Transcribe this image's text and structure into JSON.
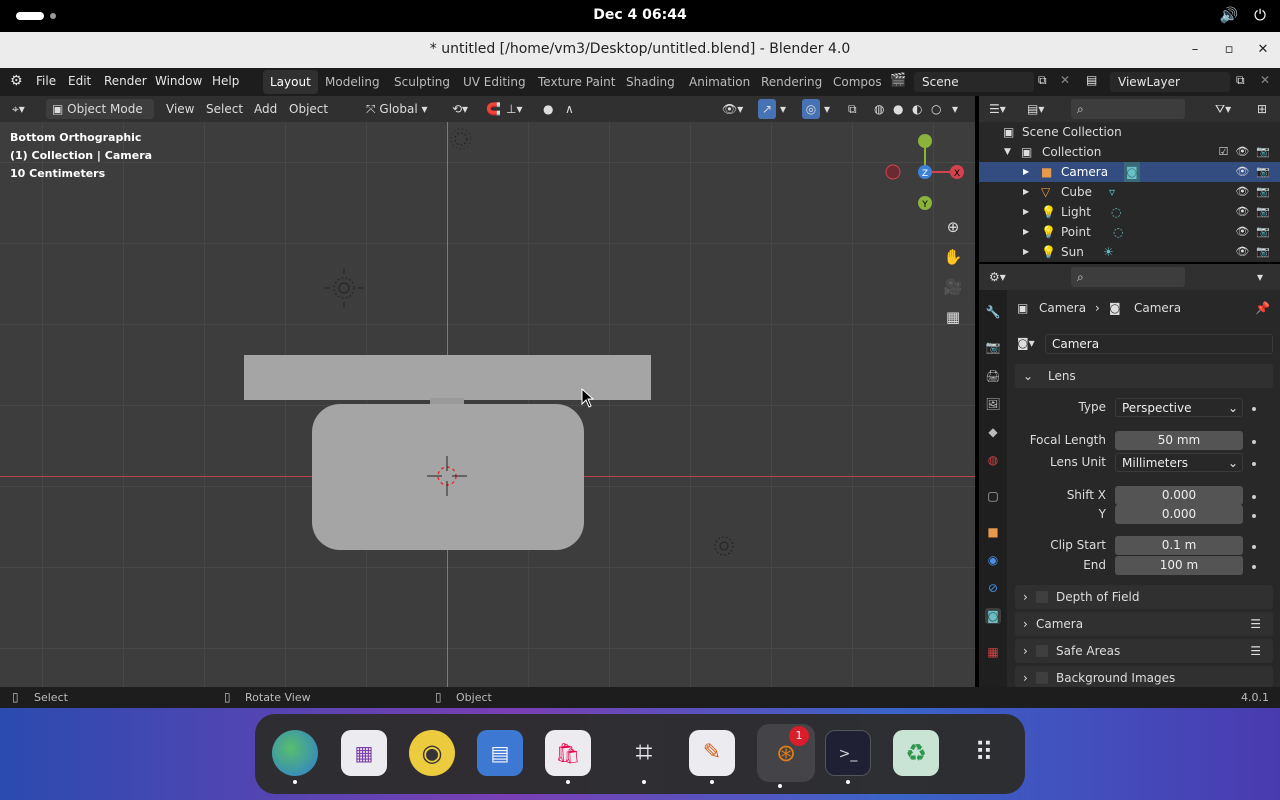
{
  "system": {
    "clock": "Dec 4  06:44"
  },
  "window": {
    "title": "* untitled [/home/vm3/Desktop/untitled.blend] - Blender 4.0"
  },
  "menu": [
    "File",
    "Edit",
    "Render",
    "Window",
    "Help"
  ],
  "workspaces": [
    "Layout",
    "Modeling",
    "Sculpting",
    "UV Editing",
    "Texture Paint",
    "Shading",
    "Animation",
    "Rendering",
    "Compos"
  ],
  "scene": {
    "name": "Scene",
    "view_layer": "ViewLayer"
  },
  "viewport_header": {
    "mode": "Object Mode",
    "view": "View",
    "select": "Select",
    "add": "Add",
    "object": "Object",
    "orientation": "Global"
  },
  "viewport_overlay": {
    "view_name": "Bottom Orthographic",
    "collection": "(1) Collection | Camera",
    "scale": "10 Centimeters"
  },
  "gizmo": {
    "z": "Z",
    "x": "X",
    "y": "Y"
  },
  "outliner": {
    "root": "Scene Collection",
    "collection": "Collection",
    "items": [
      "Camera",
      "Cube",
      "Light",
      "Point",
      "Sun"
    ]
  },
  "properties": {
    "breadcrumb_a": "Camera",
    "breadcrumb_b": "Camera",
    "datablock": "Camera",
    "lens_panel": "Lens",
    "type_label": "Type",
    "type_value": "Perspective",
    "focal_label": "Focal Length",
    "focal_value": "50 mm",
    "unit_label": "Lens Unit",
    "unit_value": "Millimeters",
    "shiftx_label": "Shift X",
    "shiftx_value": "0.000",
    "shifty_label": "Y",
    "shifty_value": "0.000",
    "clipstart_label": "Clip Start",
    "clipstart_value": "0.1 m",
    "clipend_label": "End",
    "clipend_value": "100 m",
    "panels": [
      "Depth of Field",
      "Camera",
      "Safe Areas",
      "Background Images"
    ]
  },
  "status": {
    "left": "Select",
    "middle": "Rotate View",
    "right": "Object",
    "version": "4.0.1"
  },
  "dock": {
    "badge": "1"
  }
}
